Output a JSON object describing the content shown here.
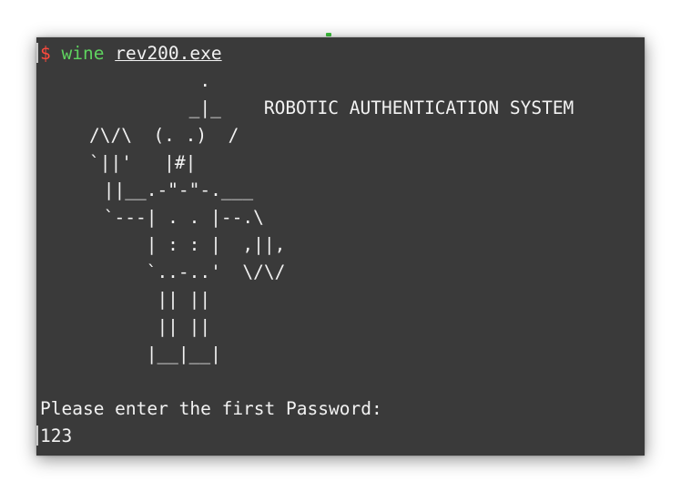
{
  "prompt": {
    "symbol": "$",
    "command": "wine",
    "argument": "rev200.exe"
  },
  "ascii_art": [
    "          .",
    "         _|_    ROBOTIC AUTHENTICATION SYSTEM",
    "/\\/\\  (. .)  /",
    "`||'   |#|",
    " ||__.-\"-\"-.___",
    " `---| . . |--.\\",
    "     | : : |  ,||,",
    "     `..-..'  \\/\\/",
    "      || ||",
    "      || ||",
    "     |__|__|"
  ],
  "password_prompt": "Please enter the first Password:",
  "user_input": "123",
  "colors": {
    "background": "#3a3a3a",
    "text": "#f2f2f2",
    "prompt_symbol": "#ff4a3d",
    "command": "#5fd35f"
  }
}
